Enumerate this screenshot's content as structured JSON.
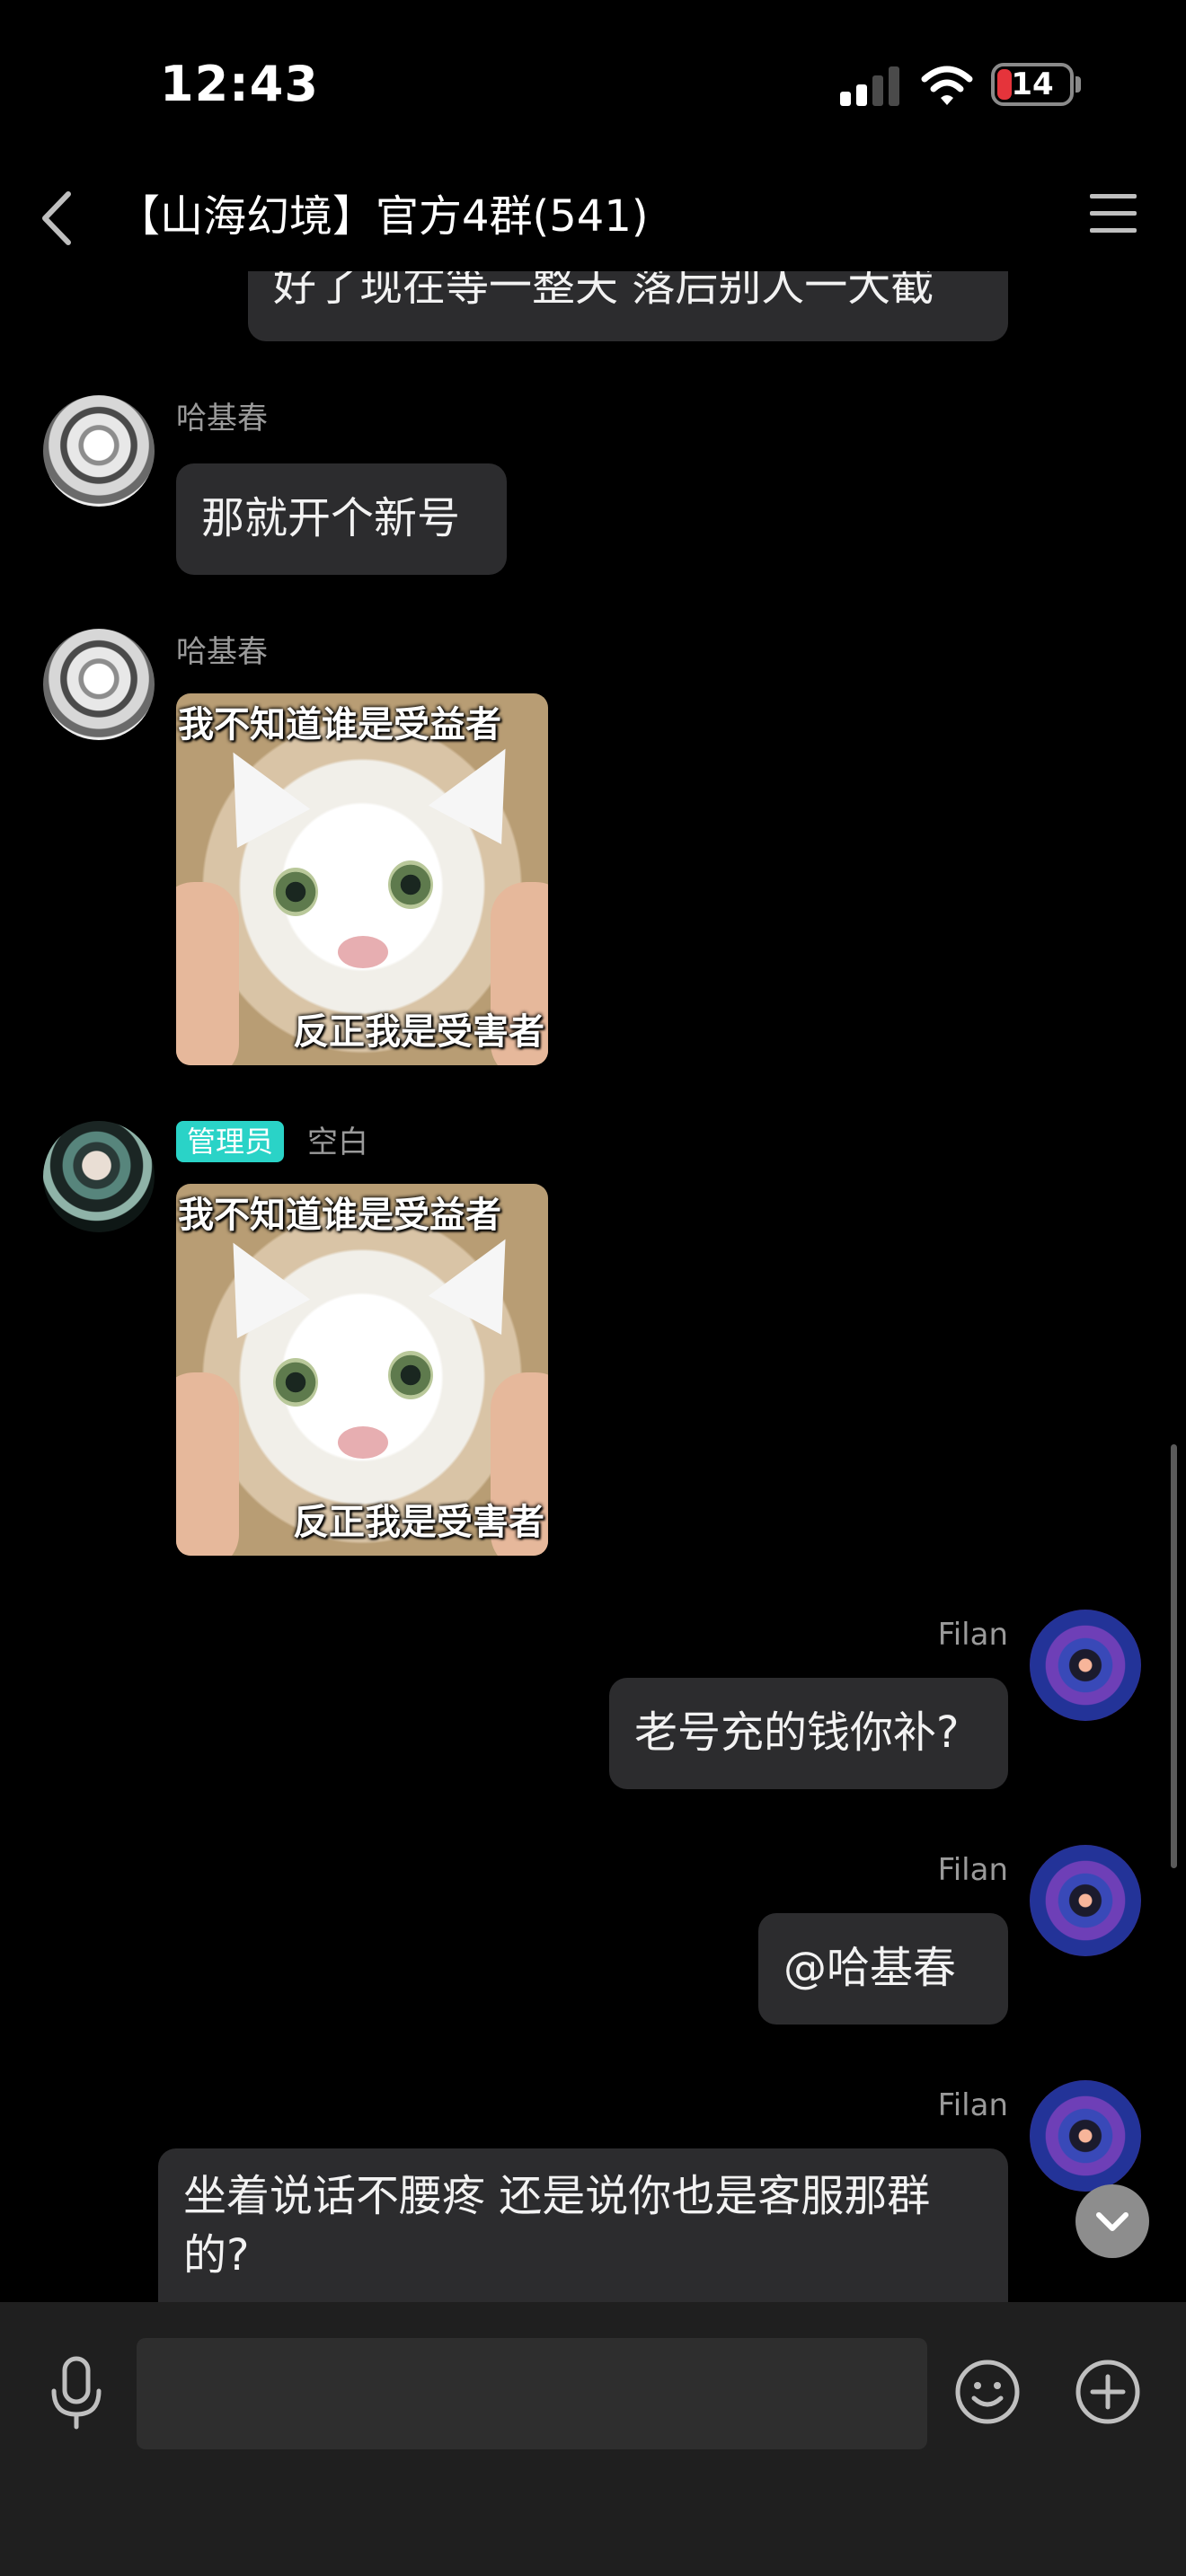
{
  "status_bar": {
    "time": "12:43",
    "battery": "14"
  },
  "header": {
    "title": "【山海幻境】官方4群(541)"
  },
  "messages": {
    "m0": {
      "text": "好了现在等一整天 落后别人一大截"
    },
    "m1": {
      "sender": "哈基春",
      "text": "那就开个新号"
    },
    "m2": {
      "sender": "哈基春",
      "caption_top": "我不知道谁是受益者",
      "caption_bottom": "反正我是受害者"
    },
    "m3": {
      "badge": "管理员",
      "sender": "空白",
      "caption_top": "我不知道谁是受益者",
      "caption_bottom": "反正我是受害者"
    },
    "m4": {
      "sender": "Filan",
      "text": "老号充的钱你补?"
    },
    "m5": {
      "sender": "Filan",
      "text": "@哈基春"
    },
    "m6": {
      "sender": "Filan",
      "text_line1": "坐着说话不腰疼 还是说你也是客服那群",
      "text_line2": "的?"
    }
  },
  "input": {
    "placeholder": ""
  },
  "icons": {
    "back": "chevron-left-icon",
    "menu": "hamburger-menu-icon",
    "mic": "microphone-icon",
    "emoji": "smiley-icon",
    "plus": "plus-circle-icon",
    "scroll": "chevron-down-icon"
  },
  "colors": {
    "background": "#000000",
    "bubble": "#2c2c2e",
    "admin_badge": "#2ad3c7",
    "battery_low": "#e5343b"
  }
}
